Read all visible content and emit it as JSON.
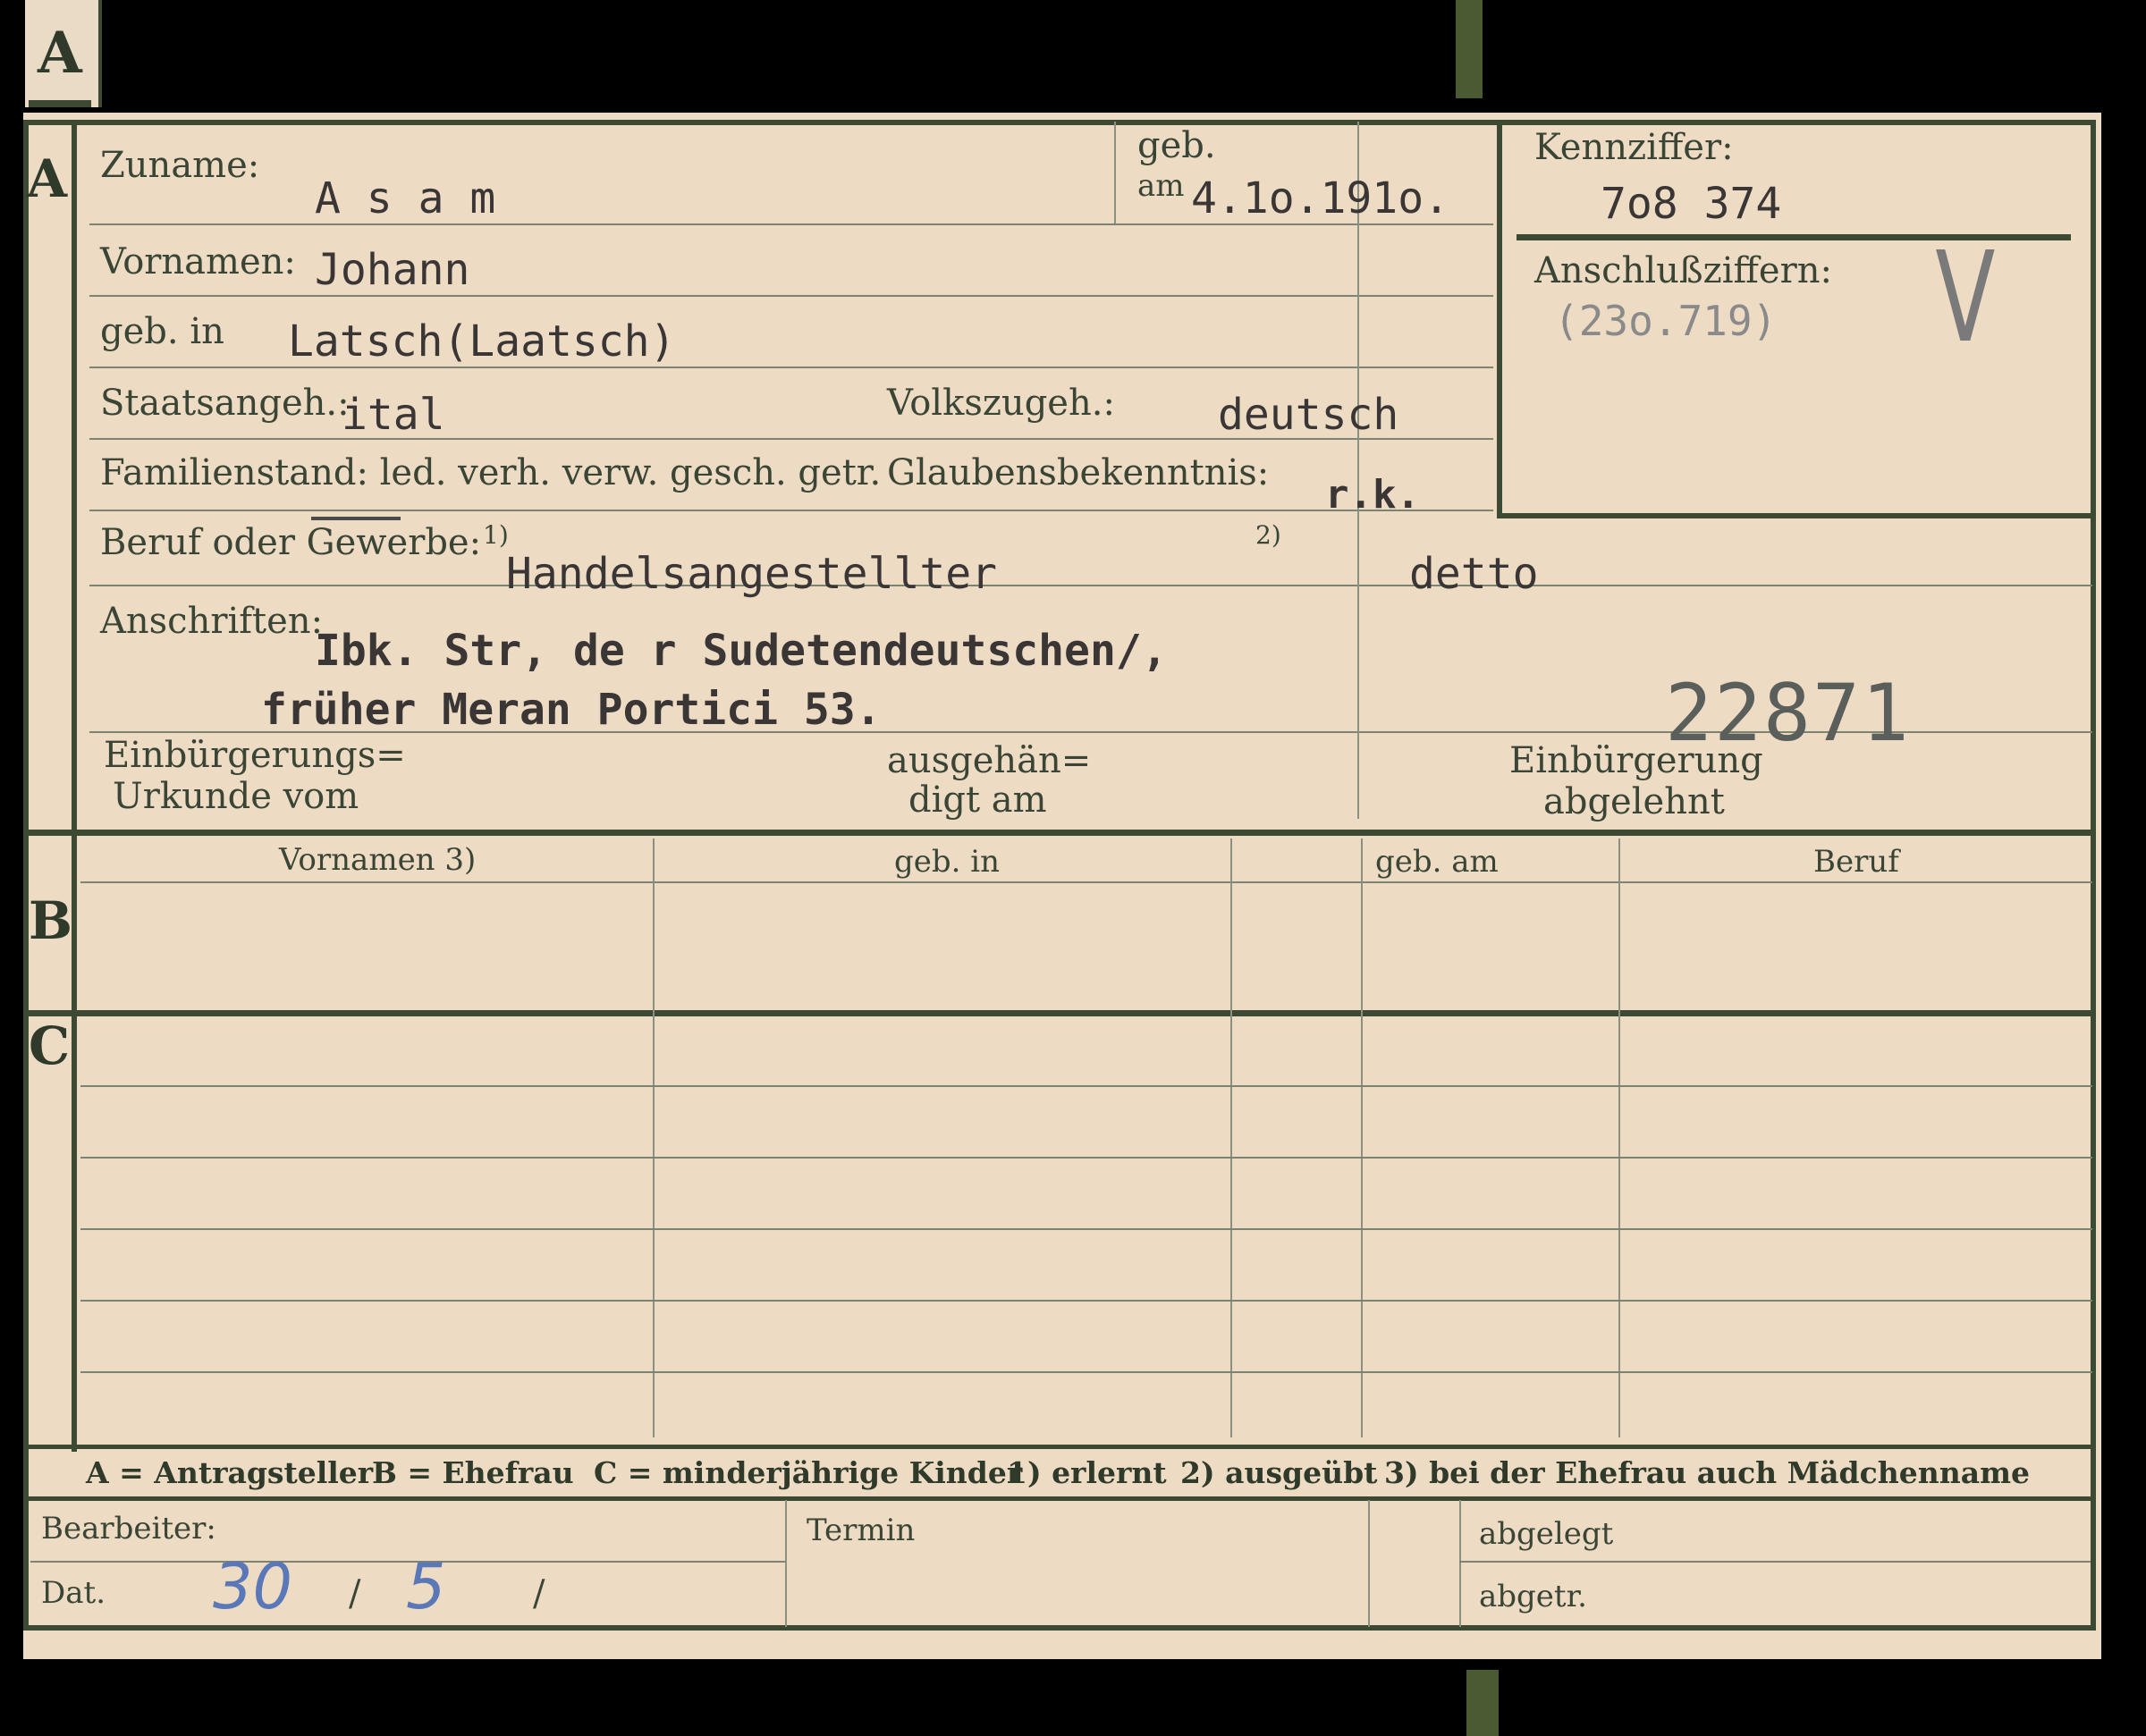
{
  "tab_letter": "A",
  "sections": {
    "a": "A",
    "b": "B",
    "c": "C"
  },
  "labels": {
    "zuname": "Zuname:",
    "geb": "geb.",
    "am": "am",
    "kennziffer": "Kennziffer:",
    "anschlussziffern": "Anschlußziffern:",
    "vornamen": "Vornamen:",
    "geb_in": "geb. in",
    "staatsangeh": "Staatsangeh.:",
    "volkszugeh": "Volkszugeh.:",
    "familienstand": "Familienstand: led. verh. verw. gesch. getr.",
    "glaubensbekenntnis": "Glaubensbekenntnis:",
    "beruf": "Beruf oder Gewerbe:",
    "note1": "1)",
    "note2": "2)",
    "anschriften": "Anschriften:",
    "einb_urkunde_1": "Einbürgerungs=",
    "einb_urkunde_2": "Urkunde vom",
    "ausgehaendigt_1": "ausgehän=",
    "ausgehaendigt_2": "digt am",
    "einb_abgelehnt_1": "Einbürgerung",
    "einb_abgelehnt_2": "abgelehnt"
  },
  "values": {
    "zuname": "A s a m",
    "geb_datum": "4.1o.191o.",
    "kennziffer": "7o8 374",
    "anschlussziffern": "(23o.719)",
    "check_mark": "V",
    "vornamen": "Johann",
    "geb_in": "Latsch(Laatsch)",
    "staatsangeh": "ital",
    "volkszugeh": "deutsch",
    "glaubensbekenntnis": "r.k.",
    "beruf_erlernt": "Handelsangestellter",
    "beruf_ausgeuebt": "detto",
    "anschrift_1": "Ibk. Str, de r  Sudetendeutschen/,",
    "anschrift_2": "früher Meran Portici 53.",
    "stamp_number": "22871"
  },
  "table_b": {
    "headers": [
      "Vornamen 3)",
      "geb. in",
      "geb. am",
      "Beruf"
    ]
  },
  "legend": {
    "a": "A = Antragsteller",
    "b": "B = Ehefrau",
    "c": "C = minderjährige Kinder",
    "n1": "1) erlernt",
    "n2": "2) ausgeübt",
    "n3": "3) bei der Ehefrau auch Mädchenname"
  },
  "footer": {
    "bearbeiter": "Bearbeiter:",
    "dat": "Dat.",
    "dat_day": "30",
    "dat_sep1": "/",
    "dat_month": "5",
    "dat_sep2": "/",
    "termin": "Termin",
    "abgelegt": "abgelegt",
    "abgetr": "abgetr."
  },
  "colors": {
    "card": "#eddbc4",
    "ink": "#3d4a33",
    "background": "#000000"
  }
}
